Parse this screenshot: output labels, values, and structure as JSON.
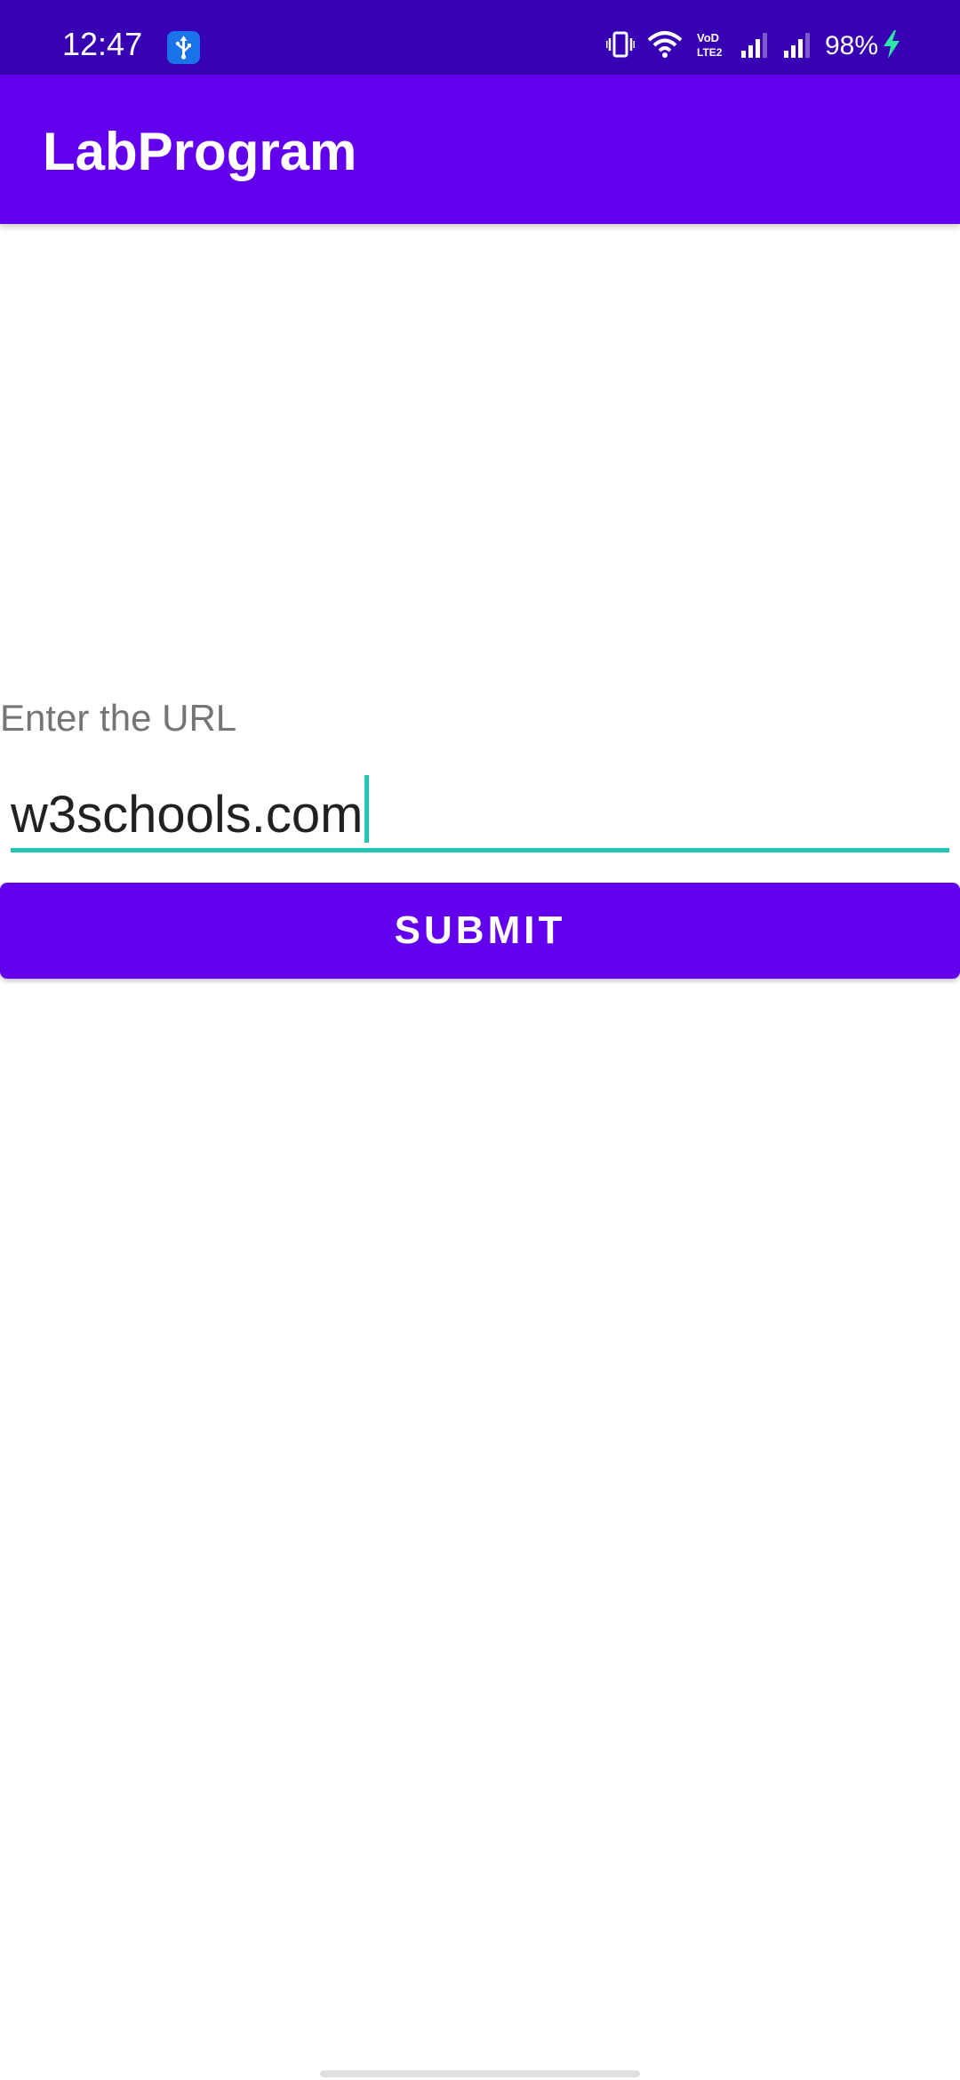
{
  "status_bar": {
    "time": "12:47",
    "battery": "98%",
    "icons": [
      "usb-debugging-icon",
      "vibrate-icon",
      "wifi-icon",
      "volte-icon",
      "signal-icon",
      "signal-icon",
      "charging-bolt-icon"
    ],
    "colors": {
      "background": "#3700b3",
      "usb_badge": "#1a73e8",
      "charging": "#2ee6a6"
    }
  },
  "app_bar": {
    "title": "LabProgram",
    "color": "#6200ee"
  },
  "form": {
    "label": "Enter the URL",
    "url_value": "w3schools.com",
    "underline_color": "#26c6b6",
    "submit_label": "SUBMIT"
  }
}
